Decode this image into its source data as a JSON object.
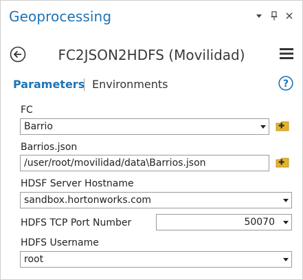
{
  "pane": {
    "title": "Geoprocessing"
  },
  "tool": {
    "title": "FC2JSON2HDFS (Movilidad)"
  },
  "tabs": {
    "parameters": "Parameters",
    "environments": "Environments"
  },
  "params": [
    {
      "label": "FC",
      "value": "Barrio"
    },
    {
      "label": "Barrios.json",
      "value": "/user/root/movilidad/data\\Barrios.json"
    },
    {
      "label": "HDSF Server Hostname",
      "value": "sandbox.hortonworks.com"
    },
    {
      "label": "HDFS TCP Port Number",
      "value": "50070"
    },
    {
      "label": "HDFS Username",
      "value": "root"
    }
  ],
  "icons": {
    "pane_menu": "dropdown-icon",
    "pin": "pin-icon",
    "close": "close-icon",
    "back": "back-arrow-icon",
    "hamburger": "hamburger-menu-icon",
    "help": "help-icon",
    "browse": "folder-browse-icon"
  },
  "colors": {
    "accent": "#1e73b5",
    "browse_folder": "#e5b22a"
  }
}
